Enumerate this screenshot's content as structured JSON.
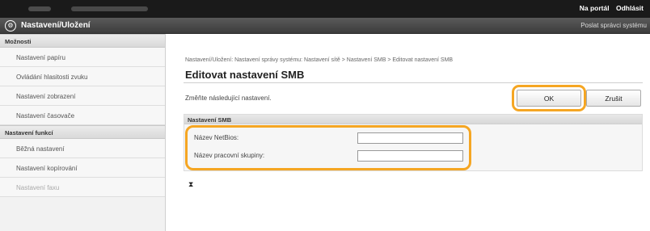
{
  "topbar": {
    "links": [
      "Na portál",
      "Odhlásit"
    ]
  },
  "titlebar": {
    "gear_icon": "gear-icon",
    "title": "Nastavení/Uložení",
    "right_text": "Poslat správci systému"
  },
  "sidebar": {
    "section1_header": "Možnosti",
    "section1_items": [
      "Nastavení papíru",
      "Ovládání hlasitosti zvuku",
      "Nastavení zobrazení",
      "Nastavení časovače"
    ],
    "section2_header": "Nastavení funkcí",
    "section2_items": [
      "Běžná nastavení",
      "Nastavení kopírování",
      "Nastavení faxu"
    ]
  },
  "main": {
    "breadcrumb": "Nastavení/Uložení: Nastavení správy systému: Nastavení sítě > Nastavení SMB > Editovat nastavení SMB",
    "page_title": "Editovat nastavení SMB",
    "description": "Změňte následující nastavení.",
    "ok_label": "OK",
    "cancel_label": "Zrušit",
    "section_title": "Nastavení SMB",
    "fields": [
      {
        "label": "Název NetBios:",
        "value": ""
      },
      {
        "label": "Název pracovní skupiny:",
        "value": ""
      }
    ],
    "collapse_glyph": "⧗"
  },
  "highlight_color": "#f5a623"
}
